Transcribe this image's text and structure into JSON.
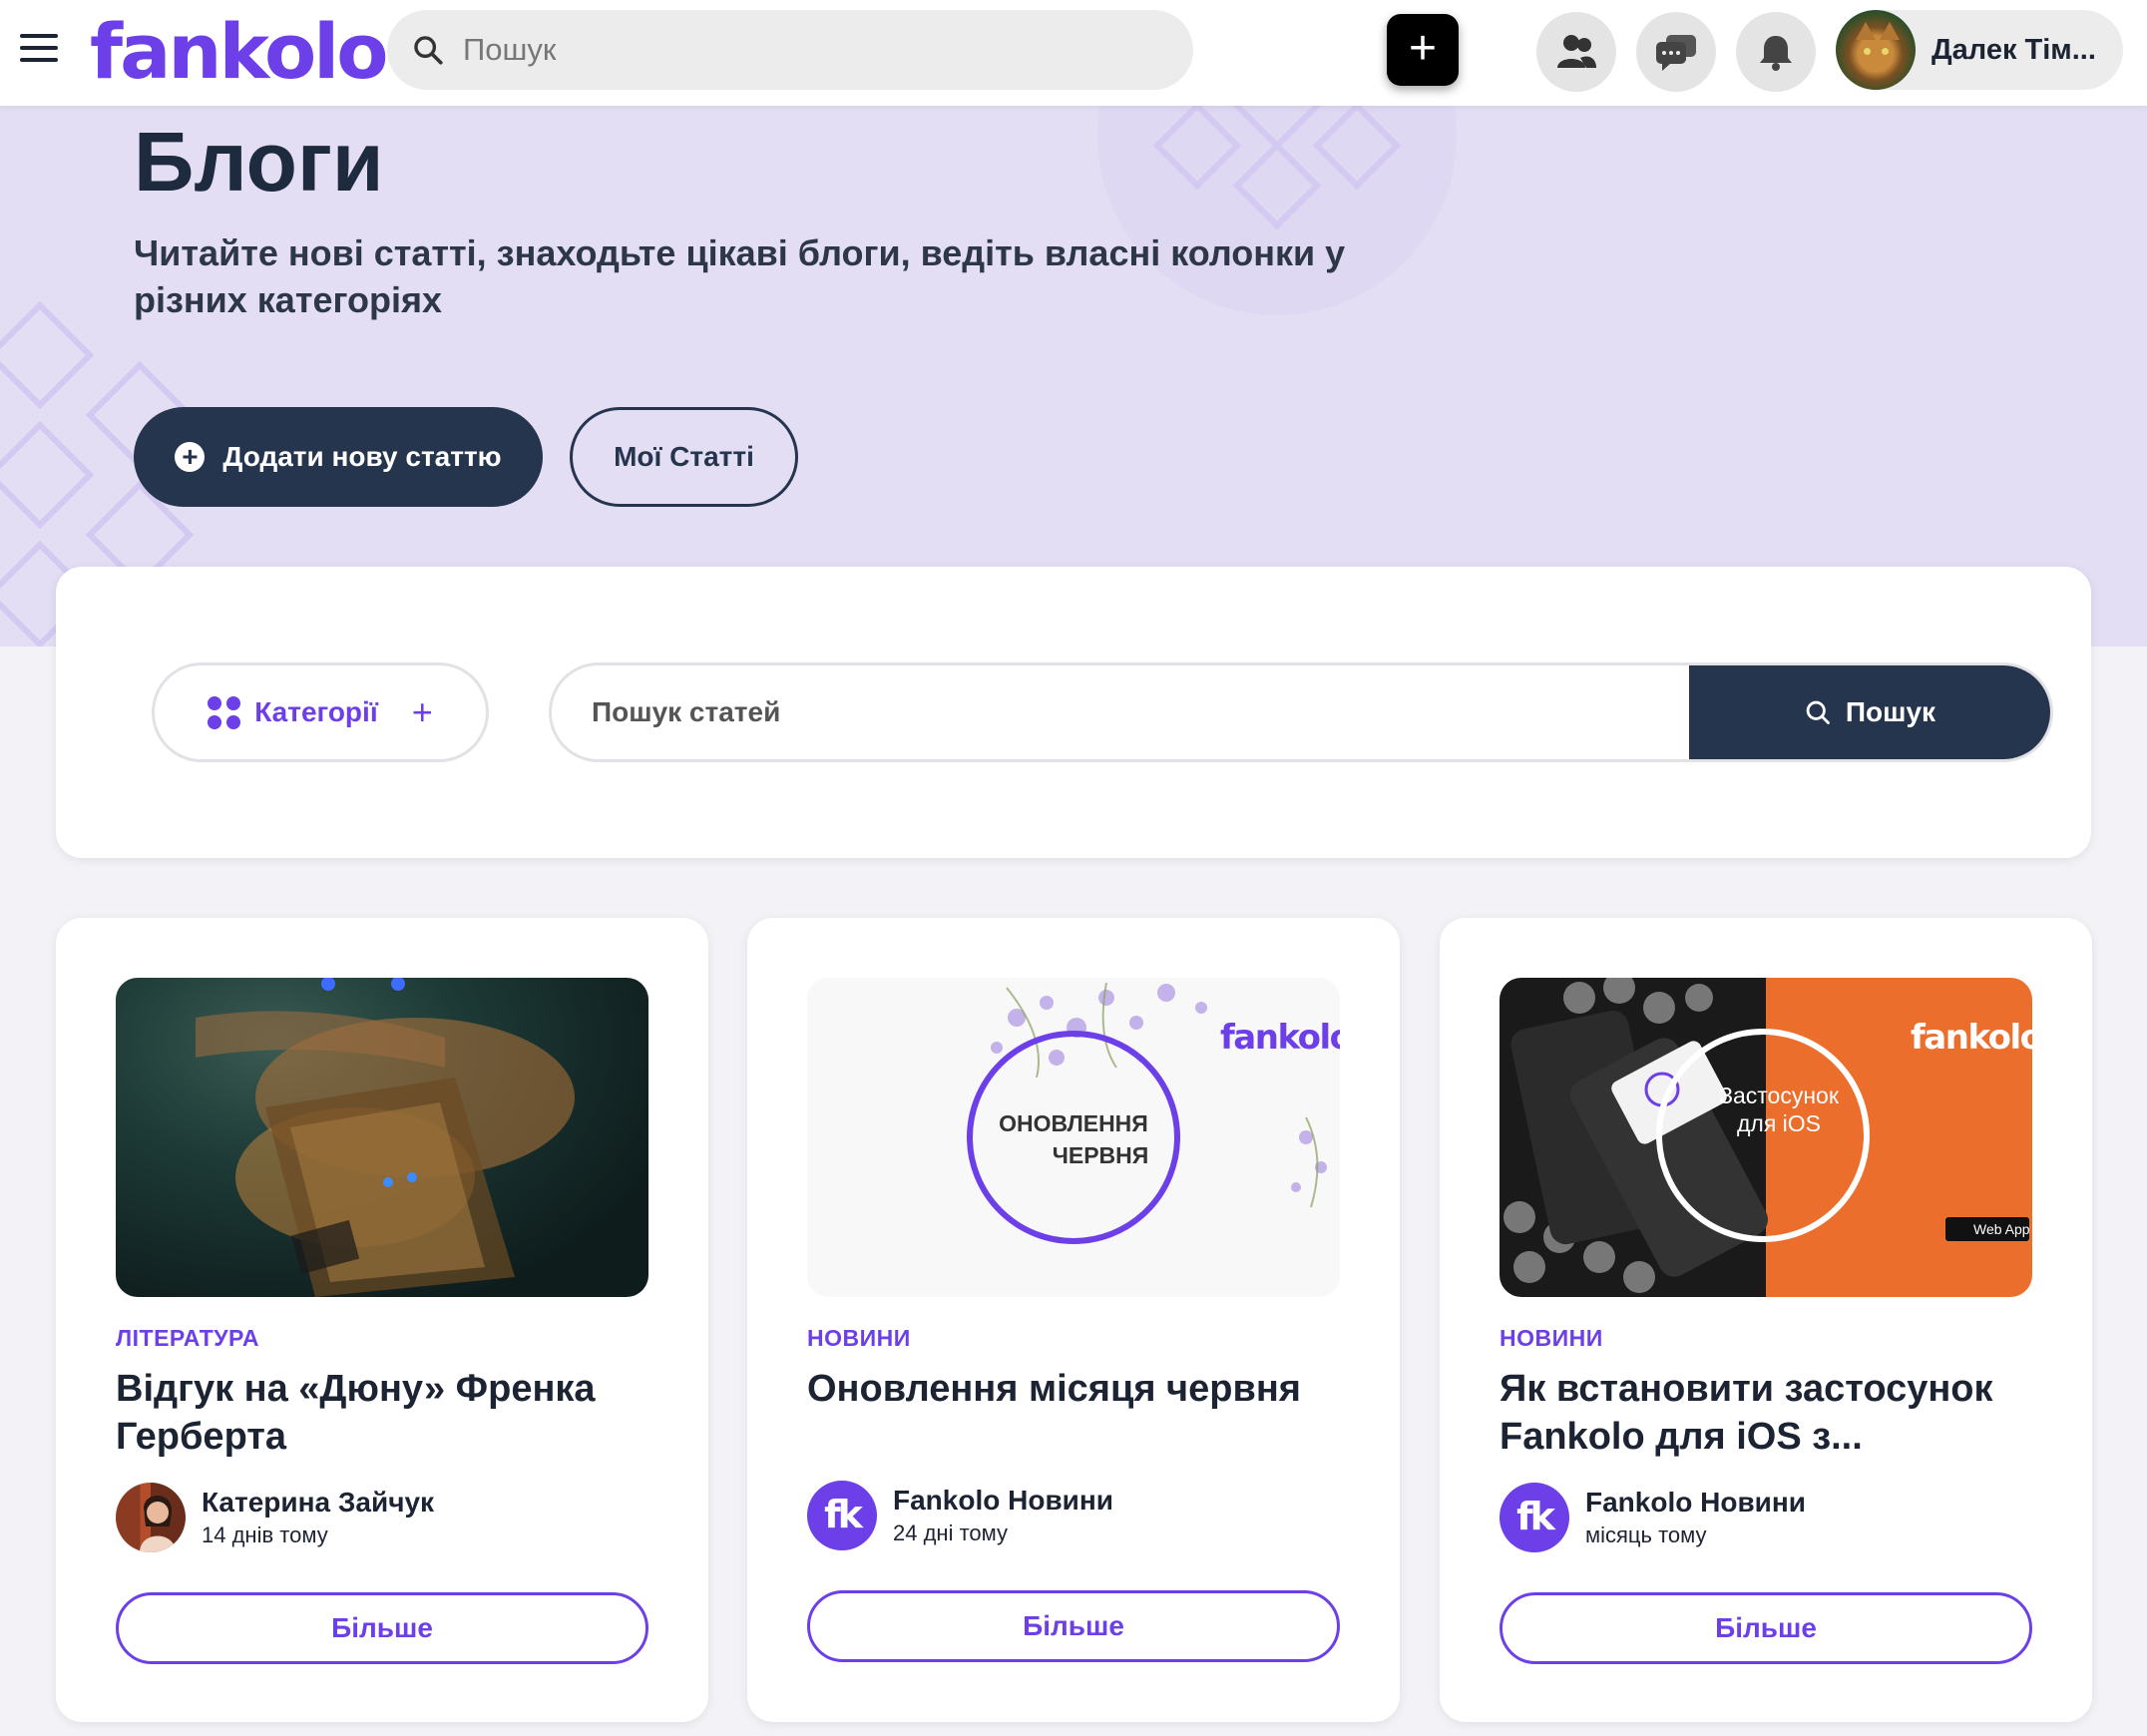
{
  "topbar": {
    "logo": "fankolo",
    "search_placeholder": "Пошук",
    "user_name": "Далек Тім..."
  },
  "hero": {
    "title": "Блоги",
    "subtitle": "Читайте нові статті, знаходьте цікаві блоги, ведіть власні колонки у різних категоріях",
    "add_button": "Додати нову статтю",
    "my_articles_button": "Мої Статті"
  },
  "filters": {
    "categories_label": "Категорії",
    "search_placeholder": "Пошук статей",
    "search_button": "Пошук"
  },
  "articles": [
    {
      "category": "ЛІТЕРАТУРА",
      "title": "Відгук на «Дюну» Френка Герберта",
      "author": "Катерина Зайчук",
      "time": "14 днів тому",
      "more": "Більше"
    },
    {
      "category": "НОВИНИ",
      "title": "Оновлення місяця червня",
      "author": "Fankolo Новини",
      "time": "24 дні тому",
      "more": "Більше",
      "image_text_1": "ОНОВЛЕННЯ",
      "image_text_2": "ЧЕРВНЯ",
      "image_logo": "fankolo"
    },
    {
      "category": "НОВИНИ",
      "title": "Як встановити застосунок Fankolo для iOS з...",
      "author": "Fankolo Новини",
      "time": "місяць тому",
      "more": "Більше",
      "image_text_1": "Застосунок",
      "image_text_2": "для iOS",
      "image_logo": "fankolo",
      "image_badge": "Web App"
    }
  ],
  "avatar_fk_text": "fk",
  "colors": {
    "brand": "#6c3fe8",
    "dark": "#26354e",
    "hero_bg": "#e3def4",
    "orange": "#ec6e2d"
  }
}
